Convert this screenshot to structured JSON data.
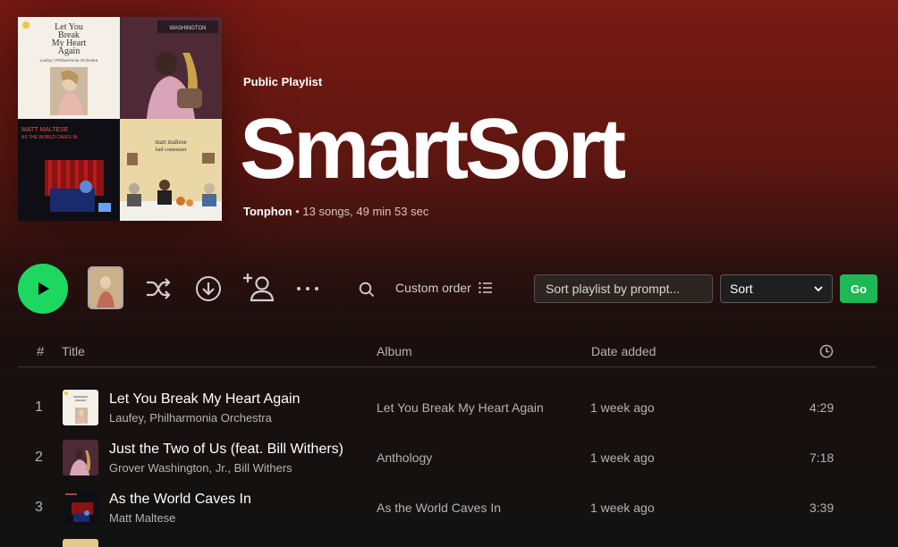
{
  "playlist": {
    "type_label": "Public Playlist",
    "title": "SmartSort",
    "owner": "Tonphon",
    "stats": " • 13 songs, 49 min 53 sec"
  },
  "cover_tiles": [
    {
      "name": "cover-let-you-break-my-heart-again",
      "text_lines": [
        "Let You",
        "Break",
        "My Heart",
        "Again"
      ],
      "credit": "Laufey | Philharmonia Orchestra"
    },
    {
      "name": "cover-anthology",
      "text": "WASHINGTON"
    },
    {
      "name": "cover-as-the-world-caves-in",
      "text_lines": [
        "MATT MALTESE",
        "AS THE WORLD CAVES IN"
      ]
    },
    {
      "name": "cover-bad-contestant",
      "text_lines": [
        "matt maltese",
        "bad contestant"
      ]
    }
  ],
  "actions": {
    "custom_order_label": "Custom order",
    "prompt_placeholder": "Sort playlist by prompt...",
    "sort_selected": "Sort",
    "go_label": "Go"
  },
  "icons": {
    "play": "play-icon",
    "shuffle": "shuffle-icon",
    "download": "download-icon",
    "add_user": "add-user-icon",
    "more": "more-icon",
    "search": "search-icon",
    "list": "list-icon",
    "clock": "clock-icon",
    "chevron": "chevron-down-icon"
  },
  "table": {
    "headers": {
      "num": "#",
      "title": "Title",
      "album": "Album",
      "date": "Date added"
    },
    "rows": [
      {
        "num": "1",
        "title": "Let You Break My Heart Again",
        "artist": "Laufey, Philharmonia Orchestra",
        "album": "Let You Break My Heart Again",
        "date": "1 week ago",
        "duration": "4:29"
      },
      {
        "num": "2",
        "title": "Just the Two of Us (feat. Bill Withers)",
        "artist": "Grover Washington, Jr., Bill Withers",
        "album": "Anthology",
        "date": "1 week ago",
        "duration": "7:18"
      },
      {
        "num": "3",
        "title": "As the World Caves In",
        "artist": "Matt Maltese",
        "album": "As the World Caves In",
        "date": "1 week ago",
        "duration": "3:39"
      }
    ]
  },
  "colors": {
    "accent_green": "#1ed760",
    "go_green": "#1db954",
    "header_red": "#7a1a14"
  }
}
